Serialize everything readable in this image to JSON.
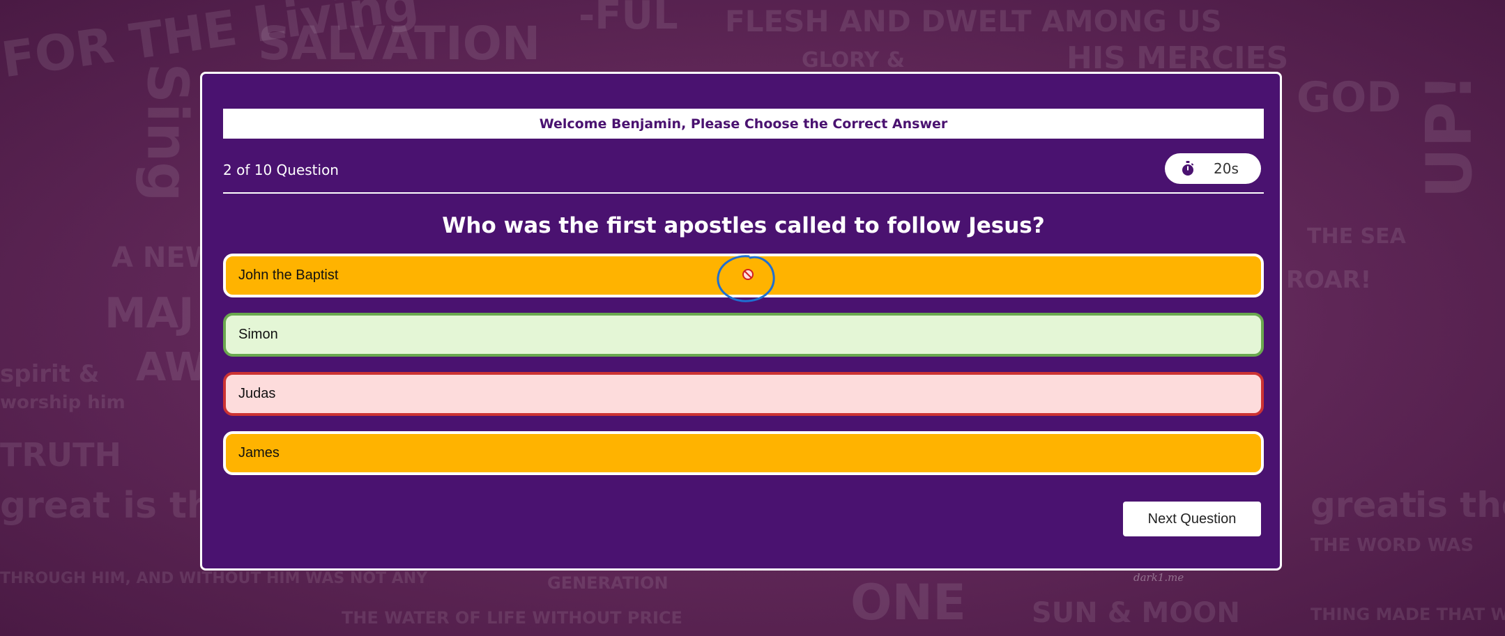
{
  "welcome_text": "Welcome Benjamin, Please Choose the Correct Answer",
  "progress": {
    "label": "2 of 10 Question",
    "current": 2,
    "total": 10
  },
  "timer": {
    "icon": "stopwatch-icon",
    "value": "20s"
  },
  "question": "Who was the first apostles called to follow Jesus?",
  "options": [
    {
      "label": "John the Baptist",
      "state": "default"
    },
    {
      "label": "Simon",
      "state": "correct"
    },
    {
      "label": "Judas",
      "state": "wrong"
    },
    {
      "label": "James",
      "state": "default"
    }
  ],
  "next_button_label": "Next Question",
  "cursor": {
    "icon": "not-allowed-icon"
  },
  "background_words": [
    "FOR THE Living",
    "SALVATION",
    "-FUL",
    "FLESH AND DWELT AMONG US",
    "HIS MERCIES",
    "GLORY &",
    "Sing",
    "A NEW SO",
    "MAJ",
    "AWE",
    "spirit &",
    "worship him",
    "TRUTH",
    "great is the",
    "GENERATION",
    "THE WATER OF LIFE WITHOUT PRICE",
    "SUN & MOON",
    "ONE",
    "ROAR!",
    "THE SEA",
    "UP!",
    "great",
    "is the",
    "GOD",
    "THE WORD WAS",
    "THROUGH HIM, AND WITHOUT HIM WAS NOT ANY",
    "THING MADE THAT WAS MADE"
  ],
  "watermark": "dark1.me",
  "colors": {
    "panel": "#4a1270",
    "option_default": "#ffb300",
    "option_correct_bg": "#e4f6d6",
    "option_correct_border": "#6aa84f",
    "option_wrong_bg": "#fddcdc",
    "option_wrong_border": "#cc3333",
    "background": "#5e2656"
  }
}
